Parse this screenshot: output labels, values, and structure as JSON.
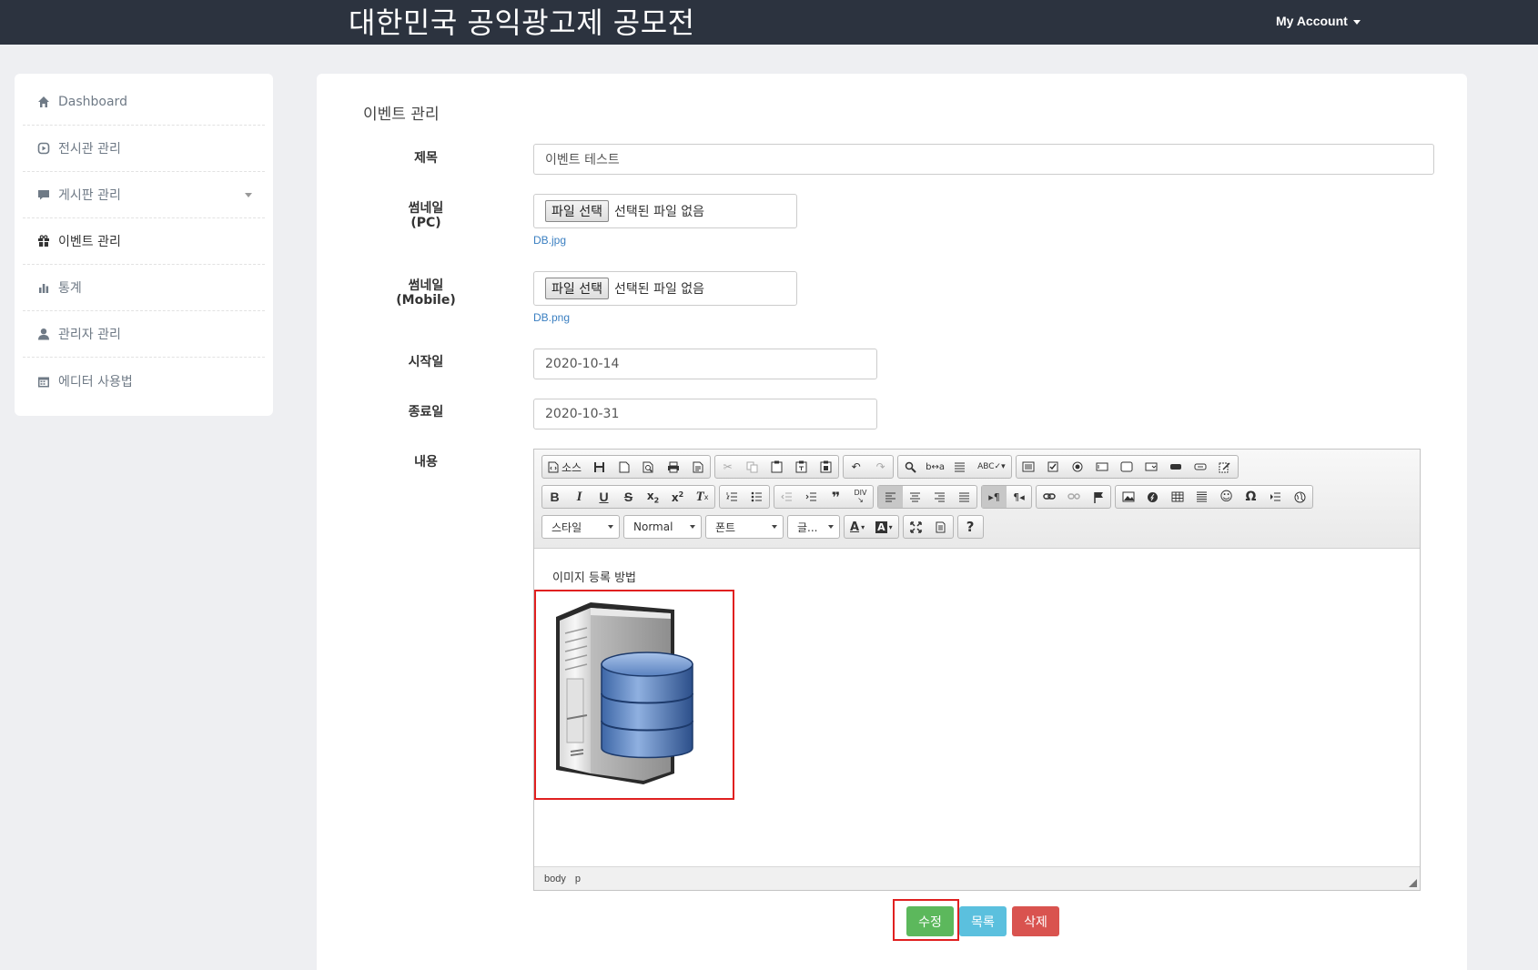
{
  "header": {
    "title": "대한민국 공익광고제 공모전",
    "account_label": "My Account"
  },
  "sidebar": {
    "items": [
      {
        "label": "Dashboard",
        "icon": "home-icon"
      },
      {
        "label": "전시관 관리",
        "icon": "play-circle-icon"
      },
      {
        "label": "게시판 관리",
        "icon": "comment-icon"
      },
      {
        "label": "이벤트 관리",
        "icon": "gift-icon"
      },
      {
        "label": "통계",
        "icon": "stats-icon"
      },
      {
        "label": "관리자 관리",
        "icon": "user-icon"
      },
      {
        "label": "에디터 사용법",
        "icon": "calendar-icon"
      }
    ],
    "active_index": 3
  },
  "main": {
    "page_title": "이벤트 관리",
    "form": {
      "title_label": "제목",
      "title_value": "이벤트 테스트",
      "thumb_pc_label_1": "썸네일",
      "thumb_pc_label_2": "(PC)",
      "thumb_mobile_label_1": "썸네일",
      "thumb_mobile_label_2": "(Mobile)",
      "file_button": "파일 선택",
      "file_none": "선택된 파일 없음",
      "thumb_pc_file": "DB.jpg",
      "thumb_mobile_file": "DB.png",
      "start_label": "시작일",
      "start_value": "2020-10-14",
      "end_label": "종료일",
      "end_value": "2020-10-31",
      "content_label": "내용"
    },
    "editor": {
      "source_label": "소스",
      "style_combo": "스타일",
      "format_combo": "Normal",
      "font_combo": "폰트",
      "size_combo": "글...",
      "help_label": "?",
      "content_text": "이미지 등록 방법",
      "status_path": [
        "body",
        "p"
      ]
    },
    "buttons": {
      "edit": "수정",
      "list": "목록",
      "delete": "삭제"
    }
  },
  "colors": {
    "header_bg": "#2c333f",
    "page_bg": "#eeeff2",
    "success": "#5cb85c",
    "info": "#5bc0de",
    "danger": "#d9534f",
    "highlight": "#e02020",
    "link": "#3a7fc1"
  }
}
